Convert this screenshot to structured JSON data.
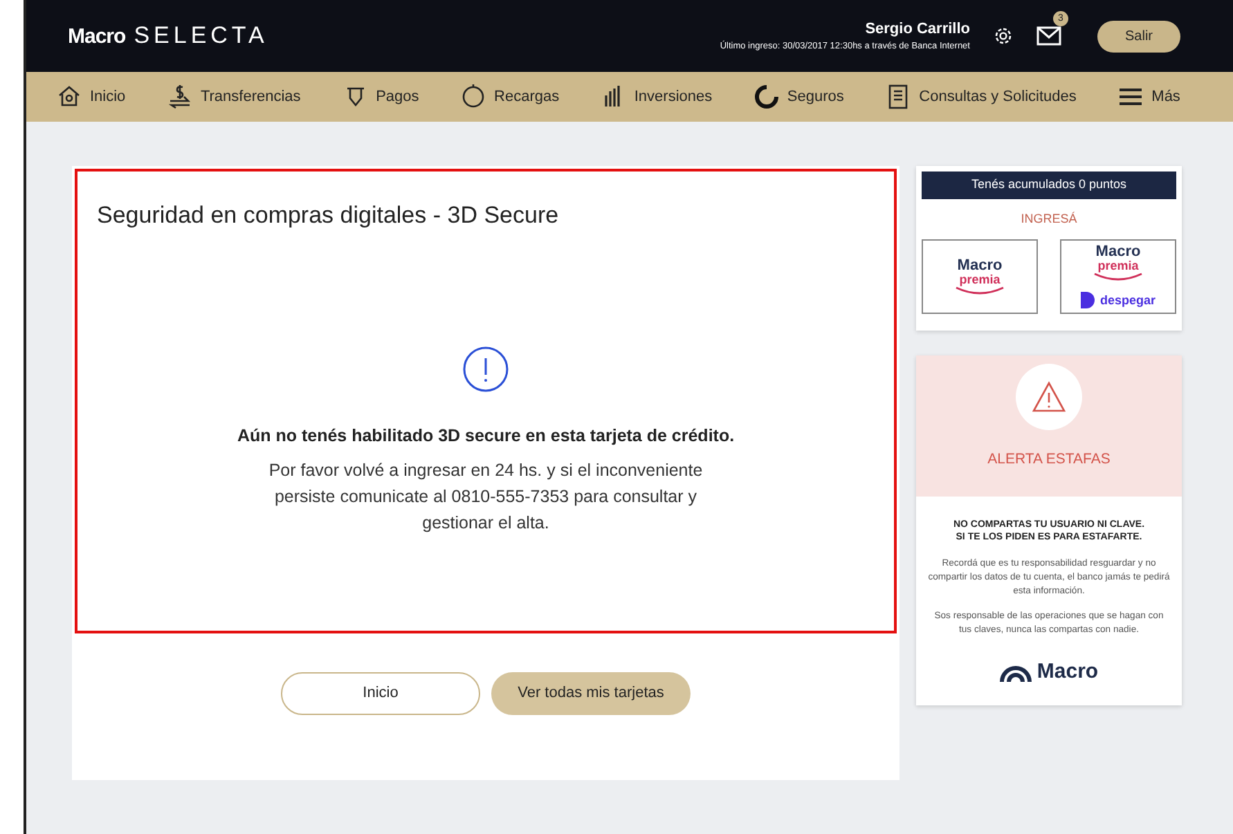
{
  "header": {
    "brand": "Macro",
    "brand_product": "SELECTA",
    "user_name": "Sergio Carrillo",
    "last_login": "Último ingreso: 30/03/2017 12:30hs a través de Banca Internet",
    "mail_badge": "3",
    "logout": "Salir"
  },
  "nav": [
    {
      "label": "Inicio"
    },
    {
      "label": "Transferencias"
    },
    {
      "label": "Pagos"
    },
    {
      "label": "Recargas"
    },
    {
      "label": "Inversiones"
    },
    {
      "label": "Seguros"
    },
    {
      "label": "Consultas y Solicitudes"
    },
    {
      "label": "Más"
    }
  ],
  "main": {
    "title": "Seguridad en compras digitales - 3D Secure",
    "highlighted": true,
    "message_title": "Aún no tenés habilitado 3D secure en esta tarjeta de crédito.",
    "message_body": "Por favor volvé a ingresar en 24 hs. y si el inconveniente persiste comunicate al 0810-555-7353 para consultar y gestionar el alta.",
    "buttons": [
      {
        "label": "Inicio",
        "kind": "outline"
      },
      {
        "label": "Ver todas mis tarjetas",
        "kind": "filled"
      }
    ]
  },
  "points": {
    "banner": "Tenés acumulados 0 puntos",
    "link": "INGRESÁ",
    "logos": [
      {
        "line1": "Macro",
        "line2": "premia"
      },
      {
        "line1": "Macro",
        "line2": "premia",
        "partner": "despegar"
      }
    ]
  },
  "alert": {
    "title": "ALERTA ESTAFAS",
    "headline": [
      "NO COMPARTAS TU USUARIO NI CLAVE.",
      "SI TE LOS PIDEN ES PARA ESTAFARTE."
    ],
    "paragraphs": [
      "Recordá que es tu responsabilidad resguardar y no compartir los datos de tu cuenta, el banco jamás te pedirá esta información.",
      "Sos responsable de las operaciones que se hagan con tus claves, nunca las compartas con nadie."
    ],
    "logo": "Macro"
  }
}
